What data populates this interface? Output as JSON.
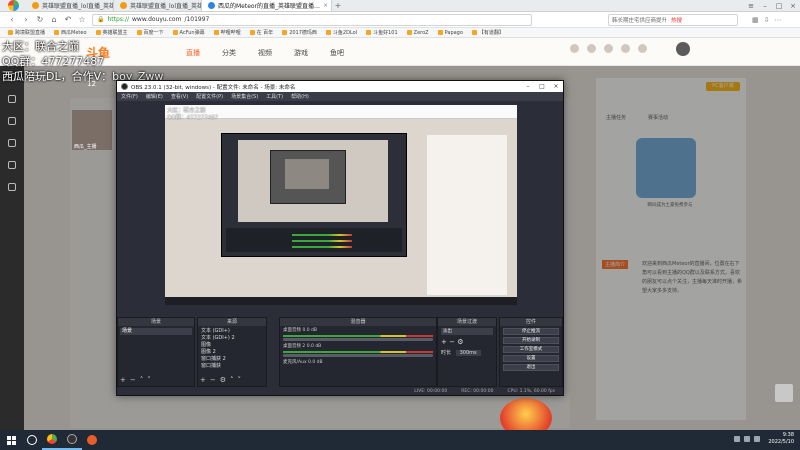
{
  "browser": {
    "tabs": [
      {
        "label": "英雄联盟直播_lol直播_英雄联盟…"
      },
      {
        "label": "英雄联盟直播_lol直播_英雄联盟…"
      },
      {
        "label": "西瓜的Meteor的直播_英雄联盟直播…",
        "active": true
      }
    ],
    "app_badge": "浏览器",
    "url_scheme": "https://",
    "url_host": "www.douyu.com",
    "url_path": "/101997",
    "search_text": "韩长期庄宅供应商提升",
    "search_hot": "热搜",
    "bookmarks": [
      "跨境联盟直播",
      "西瓜Meteo",
      "英雄联盟主",
      "百度一下",
      "AcFun弹幕",
      "哔哩哔哩",
      "在 百年",
      "2017德玛西",
      "斗鱼2DLol",
      "斗鱼好101",
      "ZeroZ",
      "Papago",
      "【有道翻】"
    ]
  },
  "site": {
    "logo": "斗鱼",
    "nav": [
      "直播",
      "分类",
      "视频",
      "游戏",
      "鱼吧"
    ],
    "room_count": "12",
    "anchor_name": "西瓜_主播",
    "pc_button": "PC客户端",
    "side_tabs": [
      "主播任务",
      "赛事活动"
    ],
    "promo_caption": "瞬间成为土豪免费参与",
    "desc_tag": "主播简介",
    "description": "欢迎来到西瓜Meteor的直播间，位置在右下角可以看到主播的QQ群以及联系方式，喜欢的朋友可以点个关注，主播每天准时开播，希望大家多多支持。"
  },
  "watermark": {
    "line1": "大区：联合之巅",
    "line2": "QQ群：477277487",
    "line3": "西瓜陪玩DL，合作V：boy_Zww"
  },
  "obs": {
    "title": "OBS 23.0.1 (32-bit, windows) - 配置文件: 未命名 - 场景: 未命名",
    "menu": [
      "文件(F)",
      "编辑(E)",
      "查看(V)",
      "配置文件(P)",
      "场景集合(S)",
      "工具(T)",
      "帮助(H)"
    ],
    "docks": {
      "scenes_title": "场景",
      "sources_title": "来源",
      "mixer_title": "混音器",
      "transitions_title": "场景过渡",
      "controls_title": "控件"
    },
    "scene_item": "场景",
    "sources": [
      "文本 (GDI+)",
      "文本 (GDI+) 2",
      "图像",
      "图像 2",
      "窗口捕获 2",
      "窗口捕获"
    ],
    "mixer": [
      {
        "label": "桌面音频",
        "value": "0.0 dB"
      },
      {
        "label": "桌面音频 2",
        "value": "0.0 dB"
      },
      {
        "label": "麦克风/Aux",
        "value": "0.0 dB"
      }
    ],
    "transition": "淡出",
    "duration_label": "时长",
    "duration_value": "300ms",
    "controls": [
      "停止推流",
      "开始录制",
      "工作室模式",
      "设置",
      "退出"
    ],
    "status": [
      "LIVE: 00:00:00",
      "REC: 00:00:00",
      "CPU: 1.1%, 60.00 fps"
    ]
  },
  "taskbar": {
    "time": "9:38",
    "date": "2022/5/10"
  }
}
